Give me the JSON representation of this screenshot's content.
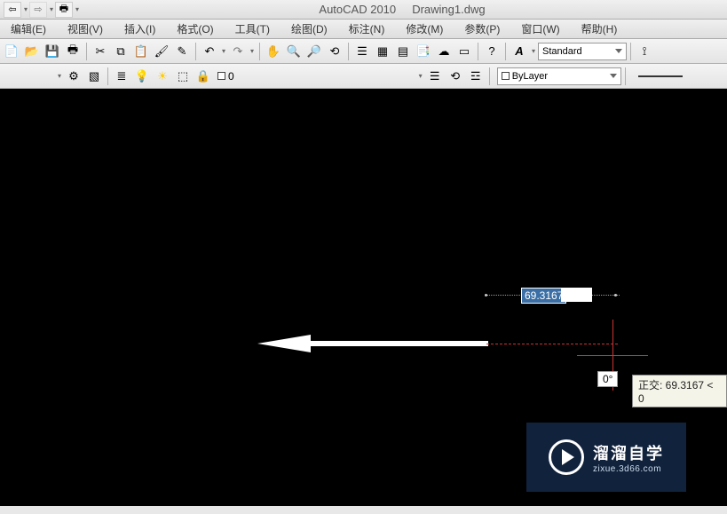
{
  "title": {
    "app": "AutoCAD 2010",
    "file": "Drawing1.dwg"
  },
  "menubar": {
    "items": [
      "编辑(E)",
      "视图(V)",
      "插入(I)",
      "格式(O)",
      "工具(T)",
      "绘图(D)",
      "标注(N)",
      "修改(M)",
      "参数(P)",
      "窗口(W)",
      "帮助(H)"
    ]
  },
  "toolbar": {
    "style_label": "Standard"
  },
  "layers": {
    "current_layer": "0",
    "bylayer_label": "ByLayer"
  },
  "canvas": {
    "dim_value": "69.3167",
    "angle_value": "0°",
    "tooltip_text": "正交: 69.3167 < 0"
  },
  "watermark": {
    "line1": "溜溜自学",
    "line2": "zixue.3d66.com"
  }
}
